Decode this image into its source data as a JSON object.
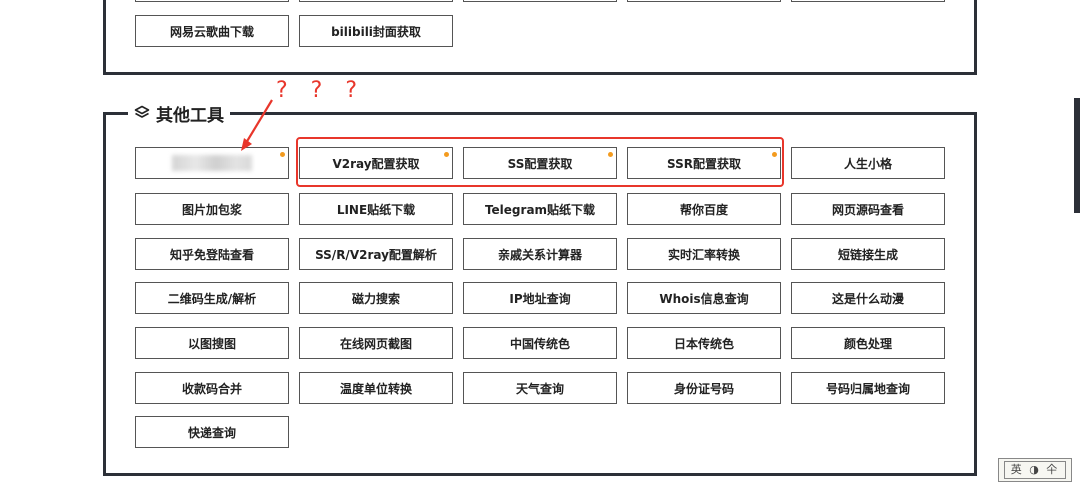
{
  "top_section": {
    "buttons": [
      {
        "label": "网易云歌曲下载"
      },
      {
        "label": "bilibili封面获取"
      }
    ]
  },
  "other_tools": {
    "title": "其他工具",
    "icon": "layers-icon",
    "rows": [
      [
        {
          "label": "",
          "blurred": true,
          "dot": true
        },
        {
          "label": "V2ray配置获取",
          "dot": true
        },
        {
          "label": "SS配置获取",
          "dot": true
        },
        {
          "label": "SSR配置获取",
          "dot": true
        },
        {
          "label": "人生小格"
        }
      ],
      [
        {
          "label": "图片加包浆"
        },
        {
          "label": "LINE贴纸下载"
        },
        {
          "label": "Telegram贴纸下载"
        },
        {
          "label": "帮你百度"
        },
        {
          "label": "网页源码查看"
        }
      ],
      [
        {
          "label": "知乎免登陆查看"
        },
        {
          "label": "SS/R/V2ray配置解析"
        },
        {
          "label": "亲戚关系计算器"
        },
        {
          "label": "实时汇率转换"
        },
        {
          "label": "短链接生成"
        }
      ],
      [
        {
          "label": "二维码生成/解析"
        },
        {
          "label": "磁力搜索"
        },
        {
          "label": "IP地址查询"
        },
        {
          "label": "Whois信息查询"
        },
        {
          "label": "这是什么动漫"
        }
      ],
      [
        {
          "label": "以图搜图"
        },
        {
          "label": "在线网页截图"
        },
        {
          "label": "中国传统色"
        },
        {
          "label": "日本传统色"
        },
        {
          "label": "颜色处理"
        }
      ],
      [
        {
          "label": "收款码合并"
        },
        {
          "label": "温度单位转换"
        },
        {
          "label": "天气查询"
        },
        {
          "label": "身份证号码"
        },
        {
          "label": "号码归属地查询"
        }
      ],
      [
        {
          "label": "快递查询"
        }
      ]
    ]
  },
  "annotation": {
    "text": "? ? ?",
    "color": "#e8362b"
  },
  "stamp": {
    "text": "英 ◑ 仐"
  },
  "colors": {
    "border": "#2c3038",
    "accent_dot": "#f39b1f",
    "annotation": "#e8362b"
  }
}
